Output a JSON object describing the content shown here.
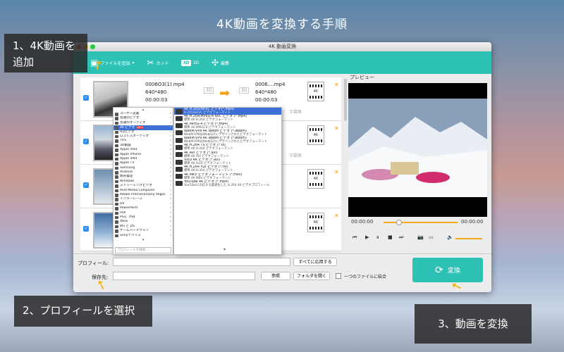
{
  "headline": "4K動画を変換する手順",
  "callouts": {
    "step1": "1、4K動画を追加",
    "step2": "2、プロフィールを選択",
    "step3": "3、動画を変換"
  },
  "window": {
    "title": "4K 動画変換"
  },
  "toolbar": {
    "add_file": "ファイルを追加",
    "cut": "カット",
    "three_d": "3D",
    "three_d_label": "3D",
    "edit": "編集"
  },
  "files": [
    {
      "name": "0006O3(1).mp4",
      "res": "640*480",
      "dur": "00:00:03",
      "out_name": "0006....mp4",
      "out_res": "640*480",
      "out_dur": "00:00:03",
      "tag": "3D",
      "segment": "字幕無"
    },
    {
      "name": "",
      "res": "",
      "dur": "",
      "out_name": "",
      "out_res": "",
      "out_dur": "",
      "tag": "",
      "segment": "字幕無"
    },
    {
      "name": "",
      "res": "",
      "dur": "",
      "out_name": "",
      "out_res": "",
      "out_dur": "",
      "tag": "",
      "segment": ""
    },
    {
      "name": "",
      "res": "",
      "dur": "",
      "out_name": "",
      "out_res": "",
      "out_dur": "",
      "tag": "",
      "segment": ""
    }
  ],
  "format_badge": "4K",
  "preview": {
    "label": "プレビュー",
    "time_start": "00:00:00",
    "time_end": "00:00:00"
  },
  "categories": [
    "ユーザー定義",
    "普通のビデオ",
    "普通のオーディオ",
    "4K ビデオ",
    "HDビデオ",
    "ロスレスオーディオ",
    "TVS",
    "3D動画",
    "Apple iPod",
    "Apple iPhone",
    "Apple iPad",
    "Apple TV",
    "Samsung",
    "Android",
    "携帯電話",
    "Windows",
    "ストリーミングビデオ",
    "Avid Media Composer",
    "Adobe Premiere/Sony Vegas",
    "インターレース",
    "DV",
    "PowerPoint",
    "PSP",
    "PS3、PS4",
    "Xbox",
    "Wii と DS",
    "ゲームハードウェア",
    "Sonyデバイス"
  ],
  "category_new_badge": "NEW",
  "formats": [
    {
      "title": "4K H.265/HEVC ビデオ(*.mp4)",
      "sub": "H.265/HEVC ビデオフォーマット"
    },
    {
      "title": "4K H.264/MPEG-4 AVC ビデオ (*.mp4)",
      "sub": "標準 4K H.264 ビデオフォーマット"
    },
    {
      "title": "4K MPEG-4 ビデオ (*.mp4)",
      "sub": "標準 4K MPEG-4 ビデオフォーマット"
    },
    {
      "title": "WebM-VP8 4K WebM ビデオ (*.webm)",
      "sub": "WebM-VP8はWeb向けにデザインされたビデオフォーマット"
    },
    {
      "title": "WebM-VP9 4K WebM ビデオ (*.webm)",
      "sub": "WebM-VP9はWeb向けにデザインされたビデオフォーマット"
    },
    {
      "title": "4K H.264 TS ビデオ (*.ts)",
      "sub": "標準 4K H.264 ビデオフォーマット"
    },
    {
      "title": "4K AVI ビデオ (*.avi)",
      "sub": "標準 4K AVI ビデオフォーマット"
    },
    {
      "title": "XviD 4K ビデオ (*.avi)",
      "sub": "標準 4K XviD ビデオフォーマット"
    },
    {
      "title": "4K H.264 FLV ビデオ (*.flv)",
      "sub": "標準 4K H.264 ビデオフォーマット"
    },
    {
      "title": "4K MKV ビデオフォーマット (*.mkv)",
      "sub": "標準 4K MKV ビデオフォーマット"
    },
    {
      "title": "YouTube 4K ビデオ (*.mp4)",
      "sub": "YouTubeに対応する最適化した H.264 4K ビデオプロフィール"
    }
  ],
  "profile": {
    "label": "プロフィール:",
    "search_placeholder": "プロフィールを検索...",
    "apply_all": "すべてに応用する"
  },
  "destination": {
    "label": "保存先:",
    "browse": "参照",
    "open_folder": "フォルダを開く",
    "merge": "一つのファイルに結合"
  },
  "convert_label": "変換",
  "colors": {
    "accent": "#2ec1b6",
    "select": "#3b6fd6",
    "arrow": "#f6a316"
  }
}
